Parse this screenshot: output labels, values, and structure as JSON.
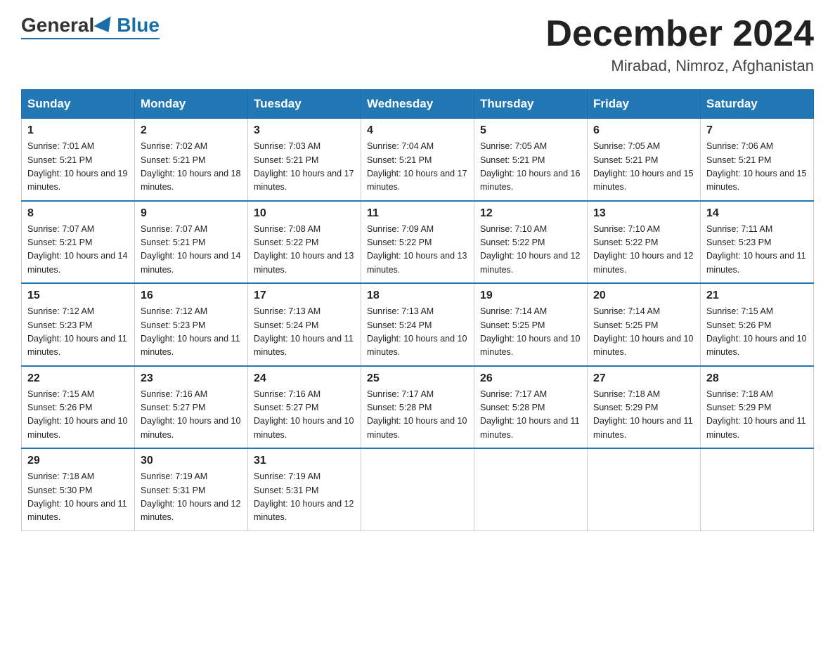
{
  "header": {
    "logo": {
      "general": "General",
      "blue": "Blue"
    },
    "title": "December 2024",
    "location": "Mirabad, Nimroz, Afghanistan"
  },
  "days_of_week": [
    "Sunday",
    "Monday",
    "Tuesday",
    "Wednesday",
    "Thursday",
    "Friday",
    "Saturday"
  ],
  "weeks": [
    [
      {
        "day": "1",
        "sunrise": "7:01 AM",
        "sunset": "5:21 PM",
        "daylight": "10 hours and 19 minutes."
      },
      {
        "day": "2",
        "sunrise": "7:02 AM",
        "sunset": "5:21 PM",
        "daylight": "10 hours and 18 minutes."
      },
      {
        "day": "3",
        "sunrise": "7:03 AM",
        "sunset": "5:21 PM",
        "daylight": "10 hours and 17 minutes."
      },
      {
        "day": "4",
        "sunrise": "7:04 AM",
        "sunset": "5:21 PM",
        "daylight": "10 hours and 17 minutes."
      },
      {
        "day": "5",
        "sunrise": "7:05 AM",
        "sunset": "5:21 PM",
        "daylight": "10 hours and 16 minutes."
      },
      {
        "day": "6",
        "sunrise": "7:05 AM",
        "sunset": "5:21 PM",
        "daylight": "10 hours and 15 minutes."
      },
      {
        "day": "7",
        "sunrise": "7:06 AM",
        "sunset": "5:21 PM",
        "daylight": "10 hours and 15 minutes."
      }
    ],
    [
      {
        "day": "8",
        "sunrise": "7:07 AM",
        "sunset": "5:21 PM",
        "daylight": "10 hours and 14 minutes."
      },
      {
        "day": "9",
        "sunrise": "7:07 AM",
        "sunset": "5:21 PM",
        "daylight": "10 hours and 14 minutes."
      },
      {
        "day": "10",
        "sunrise": "7:08 AM",
        "sunset": "5:22 PM",
        "daylight": "10 hours and 13 minutes."
      },
      {
        "day": "11",
        "sunrise": "7:09 AM",
        "sunset": "5:22 PM",
        "daylight": "10 hours and 13 minutes."
      },
      {
        "day": "12",
        "sunrise": "7:10 AM",
        "sunset": "5:22 PM",
        "daylight": "10 hours and 12 minutes."
      },
      {
        "day": "13",
        "sunrise": "7:10 AM",
        "sunset": "5:22 PM",
        "daylight": "10 hours and 12 minutes."
      },
      {
        "day": "14",
        "sunrise": "7:11 AM",
        "sunset": "5:23 PM",
        "daylight": "10 hours and 11 minutes."
      }
    ],
    [
      {
        "day": "15",
        "sunrise": "7:12 AM",
        "sunset": "5:23 PM",
        "daylight": "10 hours and 11 minutes."
      },
      {
        "day": "16",
        "sunrise": "7:12 AM",
        "sunset": "5:23 PM",
        "daylight": "10 hours and 11 minutes."
      },
      {
        "day": "17",
        "sunrise": "7:13 AM",
        "sunset": "5:24 PM",
        "daylight": "10 hours and 11 minutes."
      },
      {
        "day": "18",
        "sunrise": "7:13 AM",
        "sunset": "5:24 PM",
        "daylight": "10 hours and 10 minutes."
      },
      {
        "day": "19",
        "sunrise": "7:14 AM",
        "sunset": "5:25 PM",
        "daylight": "10 hours and 10 minutes."
      },
      {
        "day": "20",
        "sunrise": "7:14 AM",
        "sunset": "5:25 PM",
        "daylight": "10 hours and 10 minutes."
      },
      {
        "day": "21",
        "sunrise": "7:15 AM",
        "sunset": "5:26 PM",
        "daylight": "10 hours and 10 minutes."
      }
    ],
    [
      {
        "day": "22",
        "sunrise": "7:15 AM",
        "sunset": "5:26 PM",
        "daylight": "10 hours and 10 minutes."
      },
      {
        "day": "23",
        "sunrise": "7:16 AM",
        "sunset": "5:27 PM",
        "daylight": "10 hours and 10 minutes."
      },
      {
        "day": "24",
        "sunrise": "7:16 AM",
        "sunset": "5:27 PM",
        "daylight": "10 hours and 10 minutes."
      },
      {
        "day": "25",
        "sunrise": "7:17 AM",
        "sunset": "5:28 PM",
        "daylight": "10 hours and 10 minutes."
      },
      {
        "day": "26",
        "sunrise": "7:17 AM",
        "sunset": "5:28 PM",
        "daylight": "10 hours and 11 minutes."
      },
      {
        "day": "27",
        "sunrise": "7:18 AM",
        "sunset": "5:29 PM",
        "daylight": "10 hours and 11 minutes."
      },
      {
        "day": "28",
        "sunrise": "7:18 AM",
        "sunset": "5:29 PM",
        "daylight": "10 hours and 11 minutes."
      }
    ],
    [
      {
        "day": "29",
        "sunrise": "7:18 AM",
        "sunset": "5:30 PM",
        "daylight": "10 hours and 11 minutes."
      },
      {
        "day": "30",
        "sunrise": "7:19 AM",
        "sunset": "5:31 PM",
        "daylight": "10 hours and 12 minutes."
      },
      {
        "day": "31",
        "sunrise": "7:19 AM",
        "sunset": "5:31 PM",
        "daylight": "10 hours and 12 minutes."
      },
      null,
      null,
      null,
      null
    ]
  ]
}
